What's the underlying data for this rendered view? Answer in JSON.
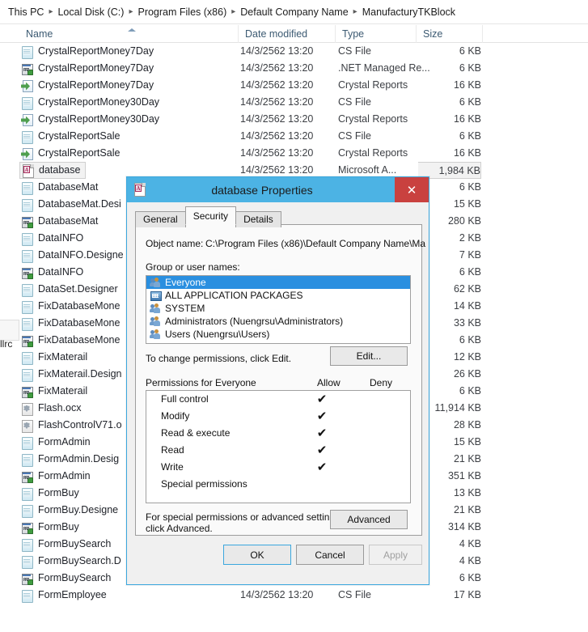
{
  "breadcrumb": {
    "items": [
      "This PC",
      "Local Disk (C:)",
      "Program Files (x86)",
      "Default Company Name",
      "ManufacturyTKBlock"
    ],
    "separator": "▸"
  },
  "columns": {
    "name": "Name",
    "date_modified": "Date modified",
    "type": "Type",
    "size": "Size",
    "sorted_by": "Name",
    "sort_direction": "asc"
  },
  "files": [
    {
      "name": "CrystalReportMoney7Day",
      "icon": "cs-file-icon",
      "date": "14/3/2562 13:20",
      "type": "CS File",
      "size": "6 KB",
      "selected": false
    },
    {
      "name": "CrystalReportMoney7Day",
      "icon": "resource-file-icon",
      "date": "14/3/2562 13:20",
      "type": ".NET Managed Re...",
      "size": "6 KB",
      "selected": false
    },
    {
      "name": "CrystalReportMoney7Day",
      "icon": "crystal-report-icon",
      "date": "14/3/2562 13:20",
      "type": "Crystal Reports",
      "size": "16 KB",
      "selected": false
    },
    {
      "name": "CrystalReportMoney30Day",
      "icon": "cs-file-icon",
      "date": "14/3/2562 13:20",
      "type": "CS File",
      "size": "6 KB",
      "selected": false
    },
    {
      "name": "CrystalReportMoney30Day",
      "icon": "crystal-report-icon",
      "date": "14/3/2562 13:20",
      "type": "Crystal Reports",
      "size": "16 KB",
      "selected": false
    },
    {
      "name": "CrystalReportSale",
      "icon": "cs-file-icon",
      "date": "14/3/2562 13:20",
      "type": "CS File",
      "size": "6 KB",
      "selected": false
    },
    {
      "name": "CrystalReportSale",
      "icon": "crystal-report-icon",
      "date": "14/3/2562 13:20",
      "type": "Crystal Reports",
      "size": "16 KB",
      "selected": false
    },
    {
      "name": "database",
      "icon": "access-db-icon",
      "date": "14/3/2562 13:20",
      "type": "Microsoft A...",
      "size": "1,984 KB",
      "selected": true
    },
    {
      "name": "DatabaseMat",
      "icon": "cs-file-icon",
      "date": "",
      "type": "",
      "size": "6 KB",
      "selected": false
    },
    {
      "name": "DatabaseMat.Desi",
      "icon": "cs-file-icon",
      "date": "",
      "type": "",
      "size": "15 KB",
      "selected": false
    },
    {
      "name": "DatabaseMat",
      "icon": "resource-file-icon",
      "date": "",
      "type": "",
      "size": "280 KB",
      "selected": false
    },
    {
      "name": "DataINFO",
      "icon": "cs-file-icon",
      "date": "",
      "type": "",
      "size": "2 KB",
      "selected": false
    },
    {
      "name": "DataINFO.Designe",
      "icon": "cs-file-icon",
      "date": "",
      "type": "",
      "size": "7 KB",
      "selected": false
    },
    {
      "name": "DataINFO",
      "icon": "resource-file-icon",
      "date": "",
      "type": "",
      "size": "6 KB",
      "selected": false
    },
    {
      "name": "DataSet.Designer",
      "icon": "cs-file-icon",
      "date": "",
      "type": "",
      "size": "62 KB",
      "selected": false
    },
    {
      "name": "FixDatabaseMone",
      "icon": "cs-file-icon",
      "date": "",
      "type": "",
      "size": "14 KB",
      "selected": false
    },
    {
      "name": "FixDatabaseMone",
      "icon": "cs-file-icon",
      "date": "",
      "type": "",
      "size": "33 KB",
      "selected": false
    },
    {
      "name": "FixDatabaseMone",
      "icon": "resource-file-icon",
      "date": "",
      "type": "",
      "size": "6 KB",
      "selected": false
    },
    {
      "name": "FixMaterail",
      "icon": "cs-file-icon",
      "date": "",
      "type": "",
      "size": "12 KB",
      "selected": false
    },
    {
      "name": "FixMaterail.Design",
      "icon": "cs-file-icon",
      "date": "",
      "type": "",
      "size": "26 KB",
      "selected": false
    },
    {
      "name": "FixMaterail",
      "icon": "resource-file-icon",
      "date": "",
      "type": "",
      "size": "6 KB",
      "selected": false
    },
    {
      "name": "Flash.ocx",
      "icon": "ocx-file-icon",
      "date": "",
      "type": "",
      "size": "11,914 KB",
      "selected": false
    },
    {
      "name": "FlashControlV71.o",
      "icon": "ocx-file-icon",
      "date": "",
      "type": "",
      "size": "28 KB",
      "selected": false
    },
    {
      "name": "FormAdmin",
      "icon": "cs-file-icon",
      "date": "",
      "type": "",
      "size": "15 KB",
      "selected": false
    },
    {
      "name": "FormAdmin.Desig",
      "icon": "cs-file-icon",
      "date": "",
      "type": "",
      "size": "21 KB",
      "selected": false
    },
    {
      "name": "FormAdmin",
      "icon": "resource-file-icon",
      "date": "",
      "type": "",
      "size": "351 KB",
      "selected": false
    },
    {
      "name": "FormBuy",
      "icon": "cs-file-icon",
      "date": "",
      "type": "",
      "size": "13 KB",
      "selected": false
    },
    {
      "name": "FormBuy.Designe",
      "icon": "cs-file-icon",
      "date": "",
      "type": "",
      "size": "21 KB",
      "selected": false
    },
    {
      "name": "FormBuy",
      "icon": "resource-file-icon",
      "date": "",
      "type": "",
      "size": "314 KB",
      "selected": false
    },
    {
      "name": "FormBuySearch",
      "icon": "cs-file-icon",
      "date": "",
      "type": "",
      "size": "4 KB",
      "selected": false
    },
    {
      "name": "FormBuySearch.D",
      "icon": "cs-file-icon",
      "date": "",
      "type": "",
      "size": "4 KB",
      "selected": false
    },
    {
      "name": "FormBuySearch",
      "icon": "resource-file-icon",
      "date": "",
      "type": "",
      "size": "6 KB",
      "selected": false
    },
    {
      "name": "FormEmployee",
      "icon": "cs-file-icon",
      "date": "14/3/2562 13:20",
      "type": "CS File",
      "size": "17 KB",
      "selected": false
    }
  ],
  "left_artifact_text": "llrc",
  "dialog": {
    "title": "database Properties",
    "title_icon": "access-db-icon",
    "close_label": "✕",
    "tabs": [
      {
        "label": "General",
        "active": false
      },
      {
        "label": "Security",
        "active": true
      },
      {
        "label": "Details",
        "active": false
      }
    ],
    "object_name_label": "Object name:",
    "object_name_value": "C:\\Program Files (x86)\\Default Company Name\\Ma",
    "groups_label": "Group or user names:",
    "groups": [
      {
        "name": "Everyone",
        "icon": "users-group-icon",
        "selected": true
      },
      {
        "name": "ALL APPLICATION PACKAGES",
        "icon": "app-packages-icon",
        "selected": false
      },
      {
        "name": "SYSTEM",
        "icon": "users-group-icon",
        "selected": false
      },
      {
        "name": "Administrators (Nuengrsu\\Administrators)",
        "icon": "users-group-icon",
        "selected": false
      },
      {
        "name": "Users (Nuengrsu\\Users)",
        "icon": "users-group-icon",
        "selected": false
      }
    ],
    "change_note": "To change permissions, click Edit.",
    "edit_button": "Edit...",
    "permissions_label": "Permissions for Everyone",
    "allow_header": "Allow",
    "deny_header": "Deny",
    "check_glyph": "✔",
    "permissions": [
      {
        "name": "Full control",
        "allow": true,
        "deny": false
      },
      {
        "name": "Modify",
        "allow": true,
        "deny": false
      },
      {
        "name": "Read & execute",
        "allow": true,
        "deny": false
      },
      {
        "name": "Read",
        "allow": true,
        "deny": false
      },
      {
        "name": "Write",
        "allow": true,
        "deny": false
      },
      {
        "name": "Special permissions",
        "allow": false,
        "deny": false
      }
    ],
    "advanced_note_line1": "For special permissions or advanced settings,",
    "advanced_note_line2": "click Advanced.",
    "advanced_button": "Advanced",
    "ok_button": "OK",
    "cancel_button": "Cancel",
    "apply_button": "Apply",
    "apply_enabled": false,
    "colors": {
      "titlebar": "#4cb3e4",
      "close_button": "#c9413f",
      "selection": "#2a8fe0",
      "dialog_face": "#f0f0f0"
    }
  }
}
